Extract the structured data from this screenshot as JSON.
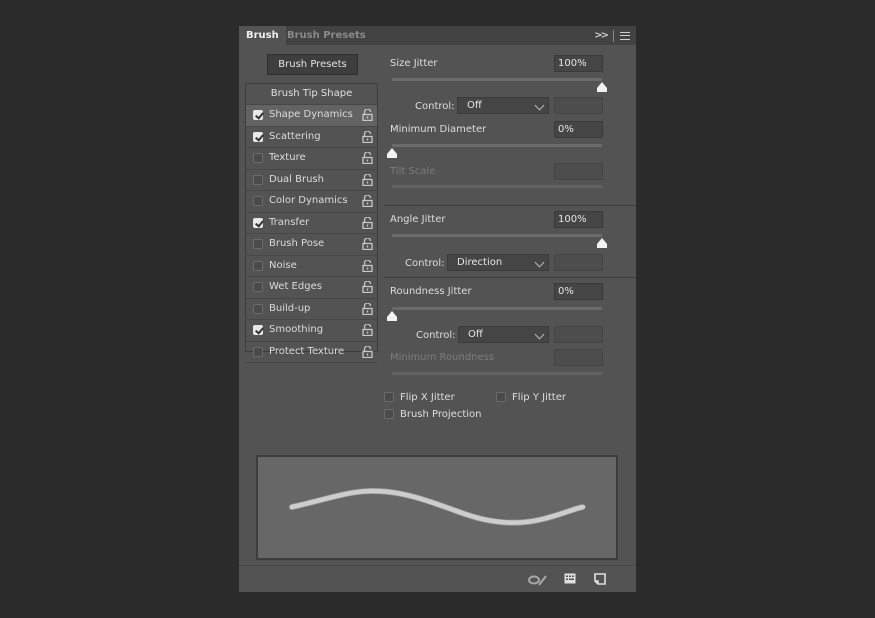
{
  "tabs": [
    {
      "label": "Brush",
      "active": true
    },
    {
      "label": "Brush Presets",
      "active": false
    }
  ],
  "toolbar_icons": [
    "collapse-panel-icon",
    "panel-menu-icon"
  ],
  "brush_presets_button": "Brush Presets",
  "brush_tip_shape": "Brush Tip Shape",
  "options": [
    {
      "label": "Shape Dynamics",
      "checked": true,
      "selected": true
    },
    {
      "label": "Scattering",
      "checked": true,
      "selected": false
    },
    {
      "label": "Texture",
      "checked": false,
      "selected": false
    },
    {
      "label": "Dual Brush",
      "checked": false,
      "selected": false
    },
    {
      "label": "Color Dynamics",
      "checked": false,
      "selected": false
    },
    {
      "label": "Transfer",
      "checked": true,
      "selected": false
    },
    {
      "label": "Brush Pose",
      "checked": false,
      "selected": false
    },
    {
      "label": "Noise",
      "checked": false,
      "selected": false
    },
    {
      "label": "Wet Edges",
      "checked": false,
      "selected": false
    },
    {
      "label": "Build-up",
      "checked": false,
      "selected": false
    },
    {
      "label": "Smoothing",
      "checked": true,
      "selected": false
    },
    {
      "label": "Protect Texture",
      "checked": false,
      "selected": false
    }
  ],
  "settings": {
    "size_jitter": {
      "label": "Size Jitter",
      "value": "100%",
      "fraction": 1.0
    },
    "size_control": {
      "label": "Control:",
      "value": "Off"
    },
    "min_diameter": {
      "label": "Minimum Diameter",
      "value": "0%",
      "fraction": 0.0
    },
    "tilt_scale": {
      "label": "Tilt Scale",
      "value": "",
      "disabled": true
    },
    "angle_jitter": {
      "label": "Angle Jitter",
      "value": "100%",
      "fraction": 1.0
    },
    "angle_control": {
      "label": "Control:",
      "value": "Direction"
    },
    "roundness_jitter": {
      "label": "Roundness Jitter",
      "value": "0%",
      "fraction": 0.0
    },
    "roundness_control": {
      "label": "Control:",
      "value": "Off"
    },
    "min_roundness": {
      "label": "Minimum Roundness",
      "value": "",
      "disabled": true
    },
    "flip_x": {
      "label": "Flip X Jitter",
      "checked": false
    },
    "flip_y": {
      "label": "Flip Y Jitter",
      "checked": false
    },
    "brush_projection": {
      "label": "Brush Projection",
      "checked": false
    }
  },
  "bottom_icons": [
    "toggle-live-tip-preview-icon",
    "brush-editor-grid-icon",
    "create-new-brush-icon"
  ],
  "colors": {
    "panel": "#535353",
    "tabbar": "#424242",
    "background": "#2b2b2b",
    "stroke": "#f2f2f2"
  }
}
